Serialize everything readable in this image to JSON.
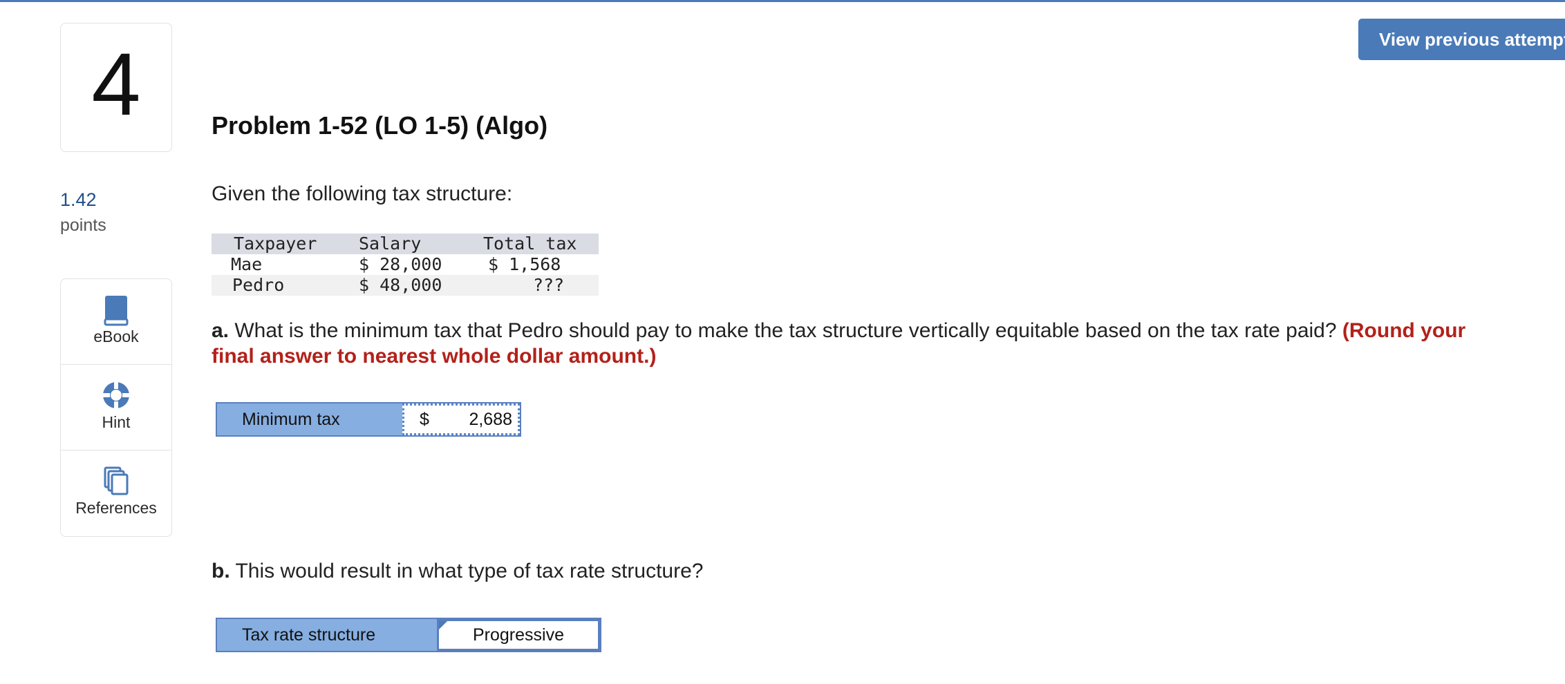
{
  "question_number": "4",
  "points": {
    "value": "1.42",
    "label": "points"
  },
  "header": {
    "view_previous": "View previous attempt"
  },
  "problem": {
    "title": "Problem 1-52 (LO 1-5) (Algo)",
    "intro": "Given the following tax structure:"
  },
  "tools": [
    {
      "label": "eBook",
      "icon": "book-icon"
    },
    {
      "label": "Hint",
      "icon": "lifebuoy-icon"
    },
    {
      "label": "References",
      "icon": "documents-icon"
    }
  ],
  "tax_table": {
    "headers": [
      "Taxpayer",
      "Salary",
      "Total tax"
    ],
    "rows": [
      [
        "Mae",
        "$ 28,000",
        "$ 1,568"
      ],
      [
        "Pedro",
        "$ 48,000",
        "???"
      ]
    ]
  },
  "part_a": {
    "letter": "a.",
    "question": " What is the minimum tax that Pedro should pay to make the tax structure vertically equitable based on the tax rate paid? ",
    "instruction": "(Round your final answer to nearest whole dollar amount.)",
    "answer_label": "Minimum tax",
    "currency": "$",
    "answer_value": "2,688"
  },
  "part_b": {
    "letter": "b.",
    "question": " This would result in what type of tax rate structure?",
    "answer_label": "Tax rate structure",
    "answer_value": "Progressive"
  },
  "colors": {
    "accent": "#4a7ab8",
    "points": "#1f4f8a",
    "instruction": "#b3211a",
    "label_fill": "#86aee0"
  }
}
